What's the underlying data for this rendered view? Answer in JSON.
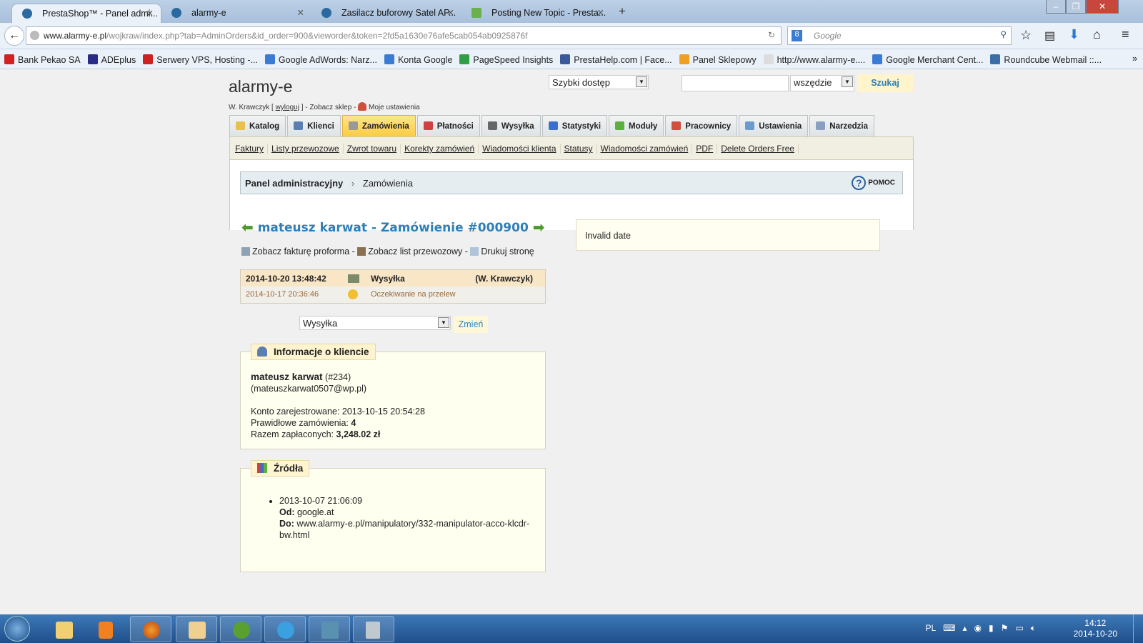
{
  "browser": {
    "tabs": [
      {
        "title": "PrestaShop™ - Panel admi...",
        "active": true
      },
      {
        "title": "alarmy-e",
        "active": false
      },
      {
        "title": "Zasilacz buforowy Satel AP...",
        "active": false
      },
      {
        "title": "Posting New Topic - Presta...",
        "active": false
      }
    ],
    "new_tab": "+",
    "url_domain": "www.alarmy-e.pl",
    "url_prefix": "",
    "url_rest": "/wojkraw/index.php?tab=AdminOrders&id_order=900&vieworder&token=2fd5a1630e76afe5cab054ab0925876f",
    "search_placeholder": "Google",
    "bookmarks": [
      {
        "label": "Bank Pekao SA",
        "color": "#d42020"
      },
      {
        "label": "ADEplus",
        "color": "#2a2a8a"
      },
      {
        "label": "Serwery VPS, Hosting -...",
        "color": "#d02020"
      },
      {
        "label": "Google AdWords: Narz...",
        "color": "#3a7bd5"
      },
      {
        "label": "Konta Google",
        "color": "#3a7bd5"
      },
      {
        "label": "PageSpeed Insights",
        "color": "#2f9e44"
      },
      {
        "label": "PrestaHelp.com | Face...",
        "color": "#3b5998"
      },
      {
        "label": "Panel Sklepowy",
        "color": "#f0a020"
      },
      {
        "label": "http://www.alarmy-e....",
        "color": "#dddddd"
      },
      {
        "label": "Google Merchant Cent...",
        "color": "#3a7bd5"
      },
      {
        "label": "Roundcube Webmail ::...",
        "color": "#3a6ea5"
      }
    ],
    "more": "»"
  },
  "header": {
    "logo": "alarmy-e",
    "user": "W. Krawczyk",
    "logout": "wyloguj",
    "view_shop": "Zobacz sklep",
    "my_settings": "Moje ustawienia",
    "quick_access": "Szybki dostęp",
    "search_value": "",
    "search_scope": "wszędzie",
    "search_button": "Szukaj"
  },
  "main_tabs": [
    {
      "label": "Katalog",
      "icon": "folder-icon",
      "color": "#e8c050"
    },
    {
      "label": "Klienci",
      "icon": "user-icon",
      "color": "#5a7fb0"
    },
    {
      "label": "Zamówienia",
      "icon": "cart-icon",
      "color": "#999999",
      "active": true
    },
    {
      "label": "Płatności",
      "icon": "payment-icon",
      "color": "#d04040"
    },
    {
      "label": "Wysyłka",
      "icon": "truck-icon",
      "color": "#666666"
    },
    {
      "label": "Statystyki",
      "icon": "chart-icon",
      "color": "#3a6ed0"
    },
    {
      "label": "Moduły",
      "icon": "puzzle-icon",
      "color": "#5cb040"
    },
    {
      "label": "Pracownicy",
      "icon": "employee-icon",
      "color": "#d05040"
    },
    {
      "label": "Ustawienia",
      "icon": "settings-icon",
      "color": "#6a9ad0"
    },
    {
      "label": "Narzedzia",
      "icon": "wrench-icon",
      "color": "#8aa0c0"
    }
  ],
  "sub_tabs": [
    "Faktury",
    "Listy przewozowe",
    "Zwrot towaru",
    "Korekty zamówień",
    "Wiadomości klienta",
    "Statusy",
    "Wiadomości zamówień",
    "PDF",
    "Delete Orders Free"
  ],
  "breadcrumb": {
    "root": "Panel administracyjny",
    "sep": "›",
    "current": "Zamówienia",
    "help": "POMOC"
  },
  "order": {
    "title": "mateusz karwat - Zamówienie #000900",
    "links": [
      "Zobacz fakturę proforma",
      "Zobacz list przewozowy",
      "Drukuj stronę"
    ],
    "link_sep": " - ",
    "history": [
      {
        "date": "2014-10-20 13:48:42",
        "status": "Wysyłka",
        "by": "(W. Krawczyk)",
        "icon": "truck-icon"
      },
      {
        "date": "2014-10-17 20:36:46",
        "status": "Oczekiwanie na przelew",
        "by": "",
        "icon": "coins-icon"
      }
    ],
    "status_select": "Wysyłka",
    "change_button": "Zmień"
  },
  "alert": "Invalid date",
  "customer": {
    "legend": "Informacje o kliencie",
    "name": "mateusz karwat",
    "id": "(#234)",
    "email": "(mateuszkarwat0507@wp.pl)",
    "registered_label": "Konto zarejestrowane:",
    "registered": "2013-10-15 20:54:28",
    "orders_label": "Prawidłowe zamówienia:",
    "orders": "4",
    "paid_label": "Razem zapłaconych:",
    "paid": "3,248.02 zł"
  },
  "sources": {
    "legend": "Źródła",
    "items": [
      {
        "date": "2013-10-07 21:06:09",
        "from_label": "Od:",
        "from": "google.at",
        "to_label": "Do:",
        "to": "www.alarmy-e.pl/manipulatory/332-manipulator-acco-klcdr-bw.html"
      }
    ]
  },
  "taskbar": {
    "lang": "PL",
    "time": "14:12",
    "date": "2014-10-20"
  }
}
